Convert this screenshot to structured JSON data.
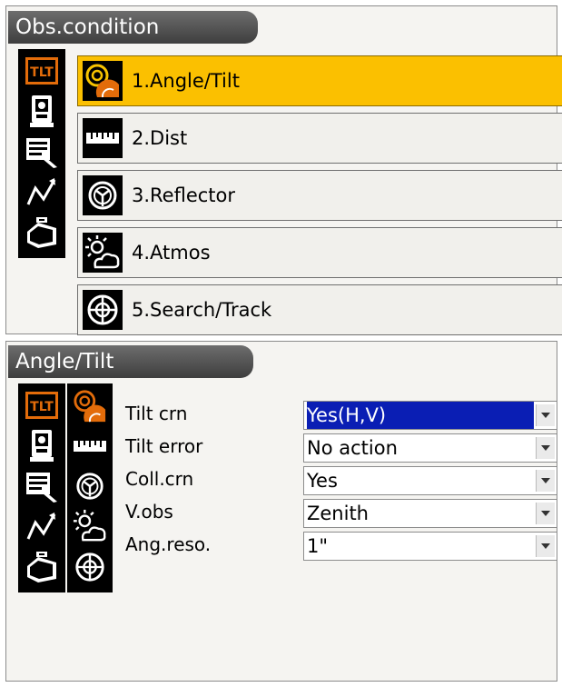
{
  "obs_condition": {
    "title": "Obs.condition",
    "menu": [
      {
        "label": "1.Angle/Tilt",
        "icon": "angle-tilt-icon",
        "selected": true
      },
      {
        "label": "2.Dist",
        "icon": "ruler-icon",
        "selected": false
      },
      {
        "label": "3.Reflector",
        "icon": "reflector-icon",
        "selected": false
      },
      {
        "label": "4.Atmos",
        "icon": "sun-cloud-icon",
        "selected": false
      },
      {
        "label": "5.Search/Track",
        "icon": "search-track-icon",
        "selected": false
      }
    ]
  },
  "angle_tilt": {
    "title": "Angle/Tilt",
    "settings": [
      {
        "label": "Tilt crn",
        "value": "Yes(H,V)"
      },
      {
        "label": "Tilt error",
        "value": "No action"
      },
      {
        "label": "Coll.crn",
        "value": "Yes"
      },
      {
        "label": "V.obs",
        "value": "Zenith"
      },
      {
        "label": "Ang.reso.",
        "value": "1\""
      }
    ]
  },
  "colors": {
    "selected_item": "#fbc000",
    "focused_value": "#0a1eb4",
    "tab_active": "#e36c0a"
  }
}
